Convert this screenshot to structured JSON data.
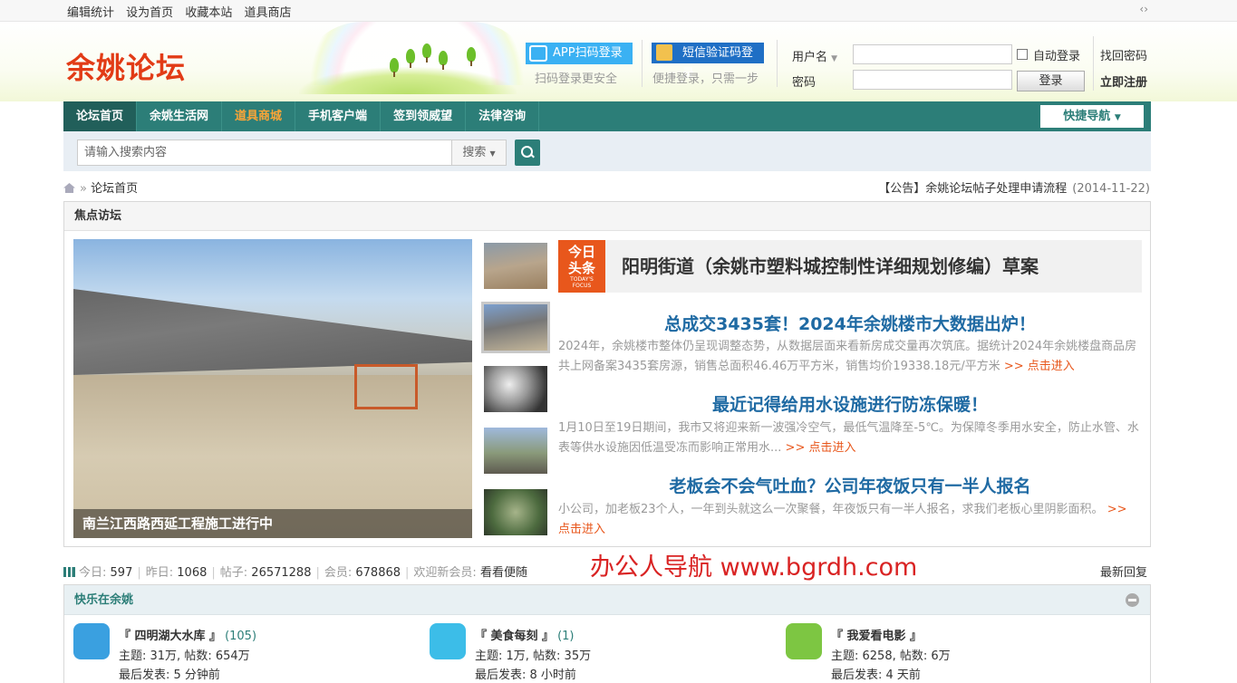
{
  "topbar": {
    "links": [
      "编辑统计",
      "设为首页",
      "收藏本站",
      "道具商店"
    ],
    "arrows": "‹›"
  },
  "header": {
    "logo": "余姚论坛",
    "qr_login": "APP扫码登录",
    "qr_sub": "扫码登录更安全",
    "sms_login": "短信验证码登录",
    "sms_sub": "便捷登录，只需一步",
    "username_label": "用户名",
    "password_label": "密码",
    "auto_login": "自动登录",
    "login_button": "登录",
    "forgot": "找回密码",
    "register": "立即注册"
  },
  "nav": {
    "items": [
      "论坛首页",
      "余姚生活网",
      "道具商城",
      "手机客户端",
      "签到领威望",
      "法律咨询"
    ],
    "quick": "快捷导航"
  },
  "search": {
    "placeholder": "请输入搜索内容",
    "select": "搜索"
  },
  "crumb": {
    "sep": "»",
    "label": "论坛首页"
  },
  "notice": {
    "text": "【公告】余姚论坛帖子处理申请流程",
    "date": "(2014-11-22)"
  },
  "focus": {
    "title": "焦点访坛",
    "main_caption": "南兰江西路西延工程施工进行中",
    "tag_big": "今日\n头条",
    "tag_small": "TODAY'S\nFOCUS",
    "headline": "阳明街道（余姚市塑料城控制性详细规划修编）草案",
    "news": [
      {
        "title": "总成交3435套！2024年余姚楼市大数据出炉！",
        "desc": "2024年，余姚楼市整体仍呈现调整态势，从数据层面来看新房成交量再次筑底。据统计2024年余姚楼盘商品房共上网备案3435套房源，销售总面积46.46万平方米，销售均价19338.18元/平方米",
        "more": ">> 点击进入"
      },
      {
        "title": "最近记得给用水设施进行防冻保暖！",
        "desc": "1月10日至19日期间，我市又将迎来新一波强冷空气，最低气温降至-5℃。为保障冬季用水安全，防止水管、水表等供水设施因低温受冻而影响正常用水...",
        "more": ">> 点击进入"
      },
      {
        "title": "老板会不会气吐血？公司年夜饭只有一半人报名",
        "desc": "小公司，加老板23个人，一年到头就这么一次聚餐，年夜饭只有一半人报名，求我们老板心里阴影面积。",
        "more": ">> 点击进入"
      }
    ]
  },
  "stats": {
    "today_label": "今日:",
    "today": "597",
    "yesterday_label": "昨日:",
    "yesterday": "1068",
    "posts_label": "帖子:",
    "posts": "26571288",
    "members_label": "会员:",
    "members": "678868",
    "welcome_label": "欢迎新会员:",
    "welcome": "看看便随",
    "latest": "最新回复"
  },
  "watermark": "办公人导航 www.bgrdh.com",
  "happy": {
    "title": "快乐在余姚",
    "forums": [
      {
        "name": "『 四明湖大水库 』",
        "count": "(105)",
        "stats": "主题: 31万, 帖数: 654万",
        "last": "最后发表: 5 分钟前",
        "icon": "diver-icon",
        "color": "#3aa0e0"
      },
      {
        "name": "『 美食每刻 』",
        "count": "(1)",
        "stats": "主题: 1万, 帖数: 35万",
        "last": "最后发表: 8 小时前",
        "icon": "plate-icon",
        "color": "#3cbde8"
      },
      {
        "name": "『 我爱看电影 』",
        "count": "",
        "stats": "主题: 6258, 帖数: 6万",
        "last": "最后发表: 4 天前",
        "icon": "film-icon",
        "color": "#7dc642"
      }
    ]
  }
}
